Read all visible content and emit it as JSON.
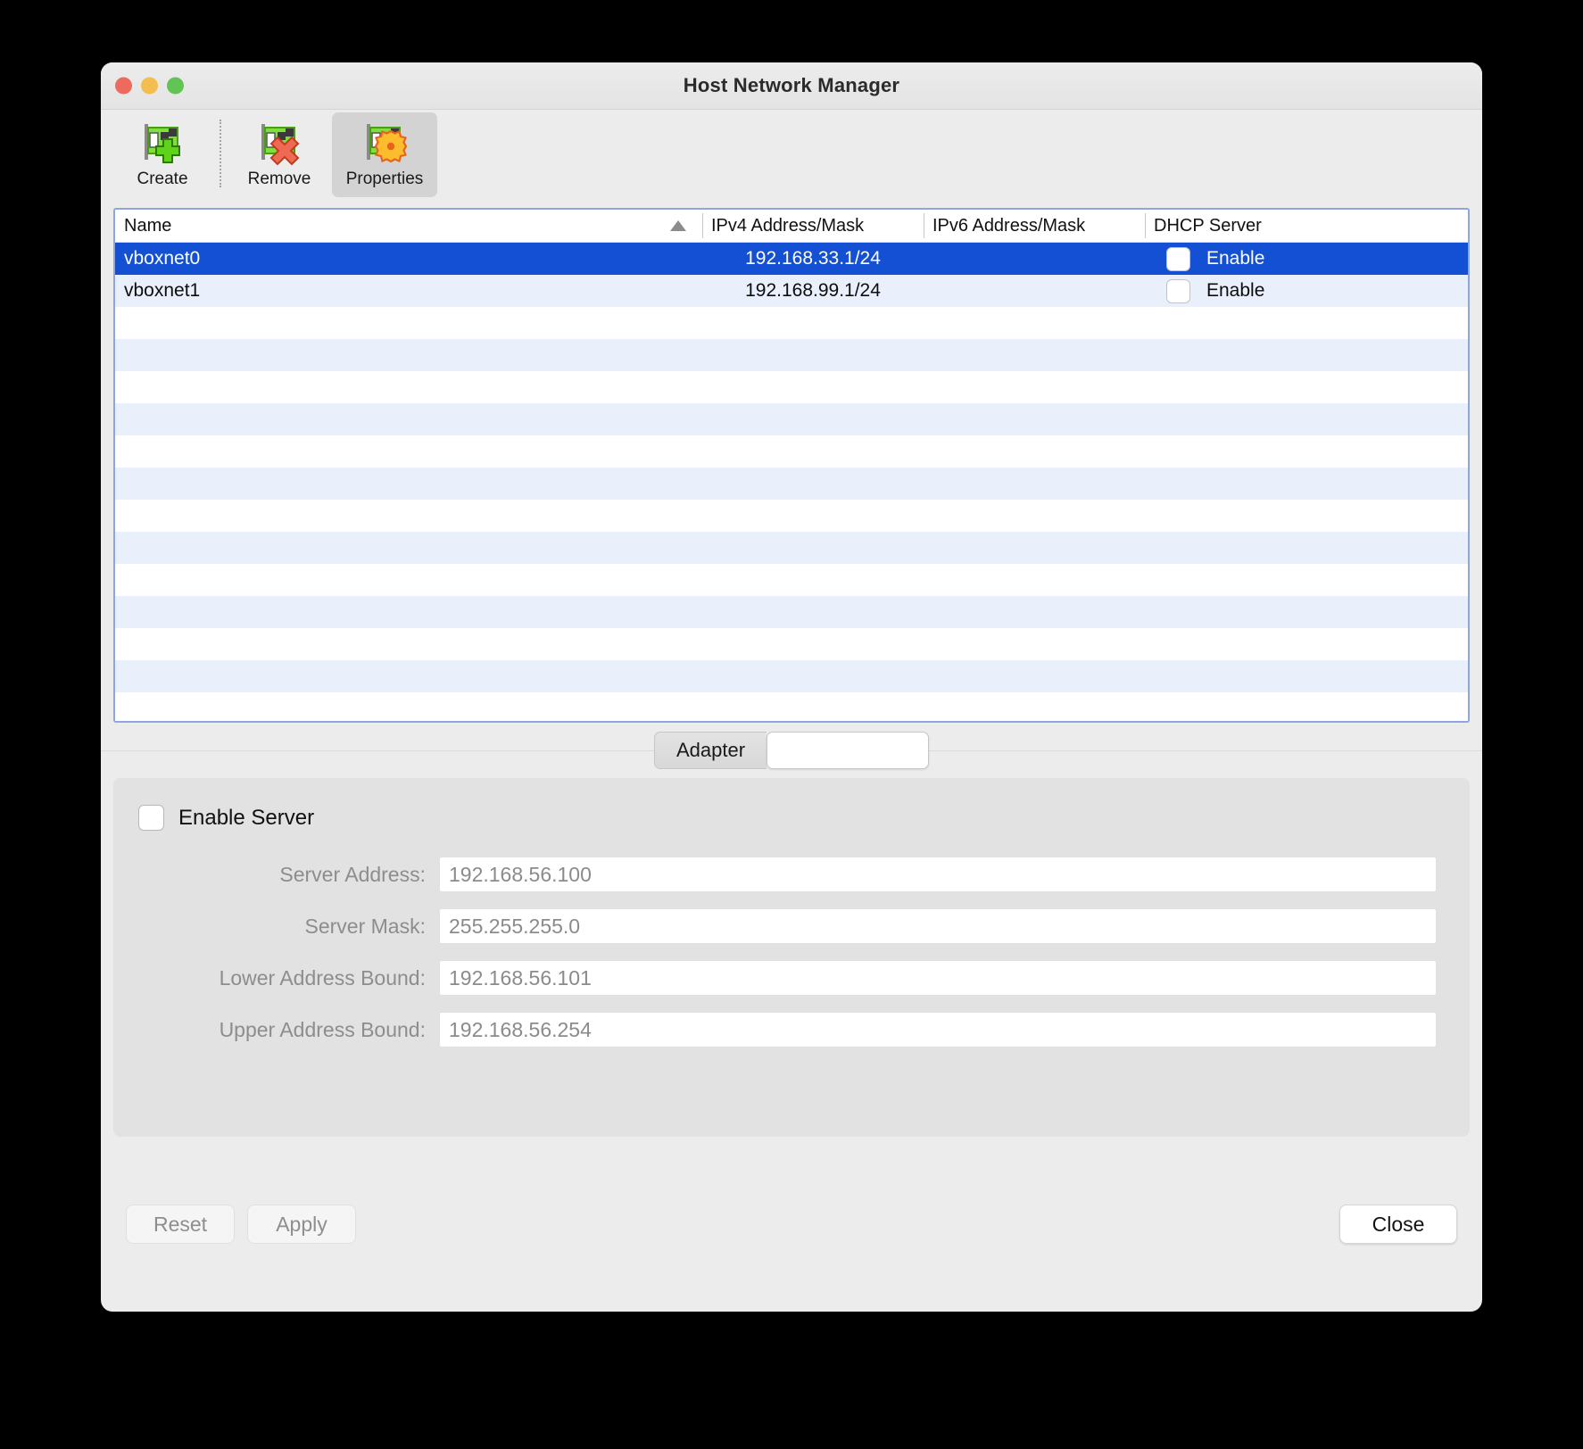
{
  "window": {
    "title": "Host Network Manager",
    "traffic_lights": [
      "close-red",
      "minimize-yellow",
      "maximize-green"
    ]
  },
  "toolbar": {
    "items": [
      {
        "label": "Create",
        "icon": "network-card-add-icon",
        "active": false
      },
      {
        "label": "Remove",
        "icon": "network-card-remove-icon",
        "active": false
      },
      {
        "label": "Properties",
        "icon": "network-card-properties-icon",
        "active": true
      }
    ]
  },
  "table": {
    "columns": [
      {
        "label": "Name",
        "sort": "ascending"
      },
      {
        "label": "IPv4 Address/Mask"
      },
      {
        "label": "IPv6 Address/Mask"
      },
      {
        "label": "DHCP Server"
      }
    ],
    "rows": [
      {
        "name": "vboxnet0",
        "ipv4": "192.168.33.1/24",
        "ipv6": "",
        "dhcp_checked": false,
        "dhcp_label": "Enable",
        "selected": true
      },
      {
        "name": "vboxnet1",
        "ipv4": "192.168.99.1/24",
        "ipv6": "",
        "dhcp_checked": false,
        "dhcp_label": "Enable",
        "selected": false
      }
    ],
    "empty_row_count": 14
  },
  "tabs": {
    "items": [
      {
        "label": "Adapter",
        "active": false
      },
      {
        "label": "",
        "active": true
      }
    ]
  },
  "panel": {
    "enable_server": {
      "label": "Enable Server",
      "checked": false
    },
    "fields": [
      {
        "label": "Server Address:",
        "value": "192.168.56.100"
      },
      {
        "label": "Server Mask:",
        "value": "255.255.255.0"
      },
      {
        "label": "Lower Address Bound:",
        "value": "192.168.56.101"
      },
      {
        "label": "Upper Address Bound:",
        "value": "192.168.56.254"
      }
    ]
  },
  "footer": {
    "reset_label": "Reset",
    "apply_label": "Apply",
    "close_label": "Close"
  },
  "colors": {
    "selection_blue": "#1450d4",
    "alt_row_blue": "#eaf0fb",
    "focus_border": "#8ea5e0",
    "window_bg": "#ececec",
    "panel_bg": "#e2e2e2"
  }
}
